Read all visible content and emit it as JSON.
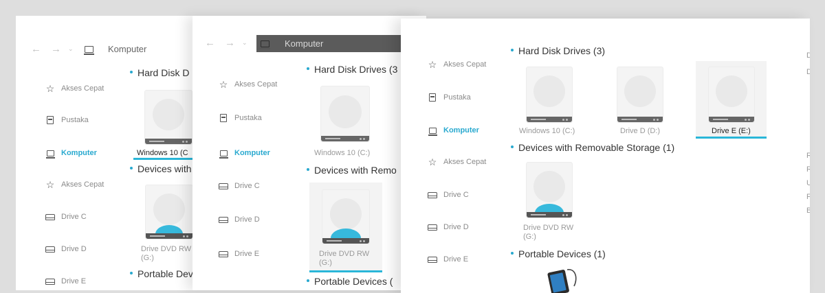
{
  "path": "Komputer",
  "sidebar": {
    "quick_access": "Akses Cepat",
    "library": "Pustaka",
    "computer": "Komputer",
    "drive_c": "Drive C",
    "drive_d": "Drive D",
    "drive_e": "Drive E"
  },
  "sections": {
    "hard_disks": "Hard Disk Drives (3)",
    "removable": "Devices with Removable Storage (1)",
    "portable": "Portable Devices (1)"
  },
  "drives": {
    "c": "Windows 10 (C:)",
    "d": "Drive D (D:)",
    "e": "Drive E (E:)",
    "dvd_line1": "Drive DVD RW",
    "dvd_line2": "(G:)"
  },
  "w1": {
    "hard_disks": "Hard Disk D",
    "removable": "Devices with",
    "portable": "Portable Dev",
    "drive_c": "Windows 10 (C",
    "dvd_line1": "Drive DVD RW"
  },
  "w2": {
    "hard_disks": "Hard Disk Drives (3",
    "removable": "Devices with Remo",
    "portable": "Portable Devices ("
  },
  "edge_letters": [
    "D",
    "D",
    "R",
    "R",
    "U",
    "F",
    "B"
  ],
  "colors": {
    "accent": "#29a9cf",
    "background": "#dedede",
    "window": "#ffffff"
  }
}
